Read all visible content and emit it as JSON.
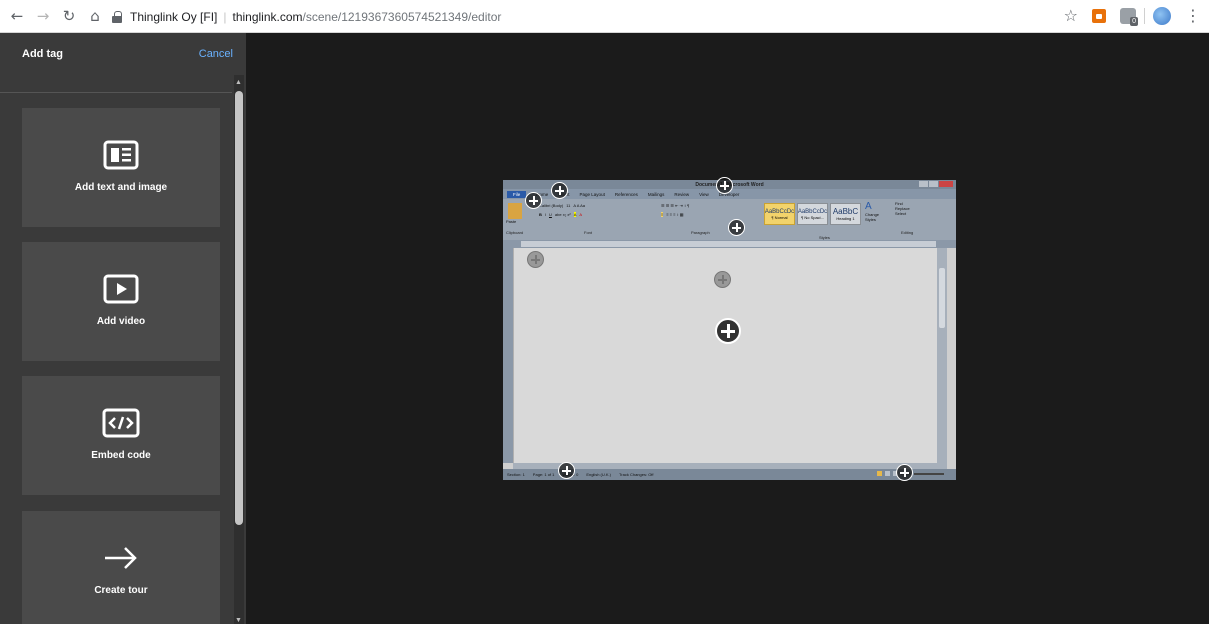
{
  "browser": {
    "site_org": "Thinglink Oy [FI]",
    "url_host": "thinglink.com",
    "url_path": "/scene/1219367360574521349/editor",
    "icons": [
      "back-arrow-icon",
      "forward-arrow-icon",
      "reload-icon",
      "home-icon",
      "lock-icon",
      "star-icon",
      "extension-icon",
      "avatar-icon",
      "menu-dots-icon"
    ]
  },
  "panel": {
    "title": "Add tag",
    "cancel_label": "Cancel",
    "options": [
      {
        "label": "Add text and image",
        "icon": "text-image-icon"
      },
      {
        "label": "Add video",
        "icon": "video-play-icon"
      },
      {
        "label": "Embed code",
        "icon": "embed-code-icon"
      },
      {
        "label": "Create tour",
        "icon": "arrow-right-icon"
      }
    ]
  },
  "scene": {
    "word_window": {
      "title": "Document1 - Microsoft Word",
      "tabs": [
        "File",
        "Home",
        "Insert",
        "Page Layout",
        "References",
        "Mailings",
        "Review",
        "View",
        "Developer"
      ],
      "font_name": "Calibri (Body)",
      "font_size": "11",
      "styles": [
        "AaBbCcDc",
        "AaBbCcDc",
        "AaBbC"
      ],
      "style_names": [
        "¶ Normal",
        "¶ No Spaci...",
        "Heading 1"
      ],
      "groups": [
        "Clipboard",
        "Font",
        "Paragraph",
        "Styles",
        "Editing"
      ],
      "change_styles": "Change Styles",
      "editing": [
        "Find",
        "Replace",
        "Select"
      ],
      "paste_label": "Paste",
      "status": [
        "Section: 1",
        "Page: 1 of 1",
        "Words: 0",
        "English (U.K.)",
        "Track Changes: Off"
      ],
      "zoom": "130%"
    },
    "hotspot_count": 10
  },
  "colors": {
    "panel_bg": "#3a3a3a",
    "tile_bg": "#4a4a4a",
    "canvas_bg": "#1b1b1b",
    "accent_link": "#6ab2ff"
  }
}
